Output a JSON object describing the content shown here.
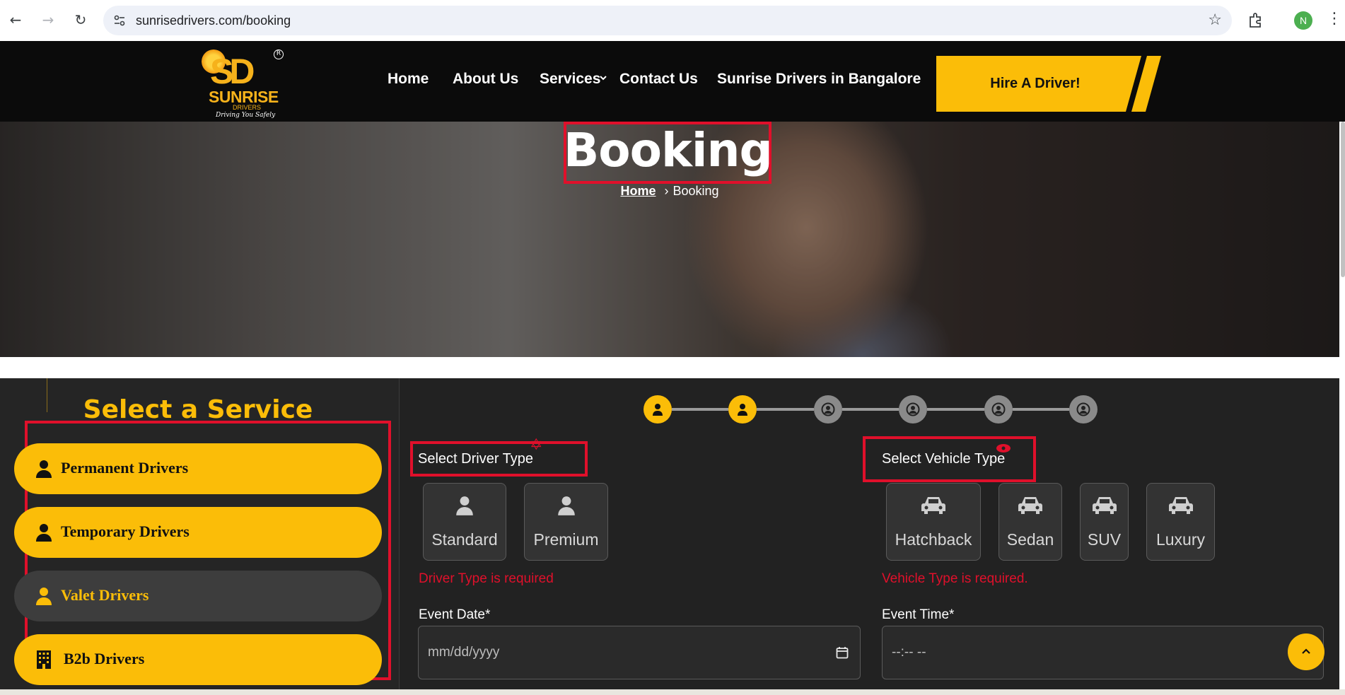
{
  "browser": {
    "url": "sunrisedrivers.com/booking",
    "profile_initial": "N"
  },
  "header": {
    "logo": {
      "mark": "SD",
      "name": "SUNRISE",
      "sub": "DRIVERS",
      "tagline": "Driving You Safely",
      "registered": "R"
    },
    "nav": [
      {
        "label": "Home"
      },
      {
        "label": "About Us"
      },
      {
        "label": "Services"
      },
      {
        "label": "Contact Us"
      },
      {
        "label": "Sunrise Drivers in Bangalore"
      }
    ],
    "cta_label": "Hire A Driver!"
  },
  "hero": {
    "title": "Booking",
    "breadcrumb": {
      "home": "Home",
      "current": "Booking"
    }
  },
  "sidebar": {
    "heading": "Select a Service",
    "items": [
      {
        "label": "Permanent Drivers",
        "icon": "user-icon",
        "active": true
      },
      {
        "label": "Temporary Drivers",
        "icon": "user-icon",
        "active": true
      },
      {
        "label": "Valet Drivers",
        "icon": "user-icon",
        "active": false
      },
      {
        "label": "B2b Drivers",
        "icon": "building-icon",
        "active": true
      }
    ]
  },
  "stepper": {
    "total_steps": 6,
    "completed_steps": 2
  },
  "form": {
    "driver_type": {
      "label": "Select Driver Type",
      "options": [
        "Standard",
        "Premium"
      ],
      "error": "Driver Type is required"
    },
    "vehicle_type": {
      "label": "Select Vehicle Type",
      "options": [
        "Hatchback",
        "Sedan",
        "SUV",
        "Luxury"
      ],
      "error": "Vehicle Type is required."
    },
    "event_date": {
      "label": "Event Date*",
      "placeholder": "mm/dd/yyyy"
    },
    "event_time": {
      "label": "Event Time*",
      "placeholder": "--:-- --"
    }
  },
  "colors": {
    "accent": "#fbbd08",
    "error": "#e0102b",
    "header_bg": "#0b0b0b",
    "panel_bg": "#222222"
  }
}
